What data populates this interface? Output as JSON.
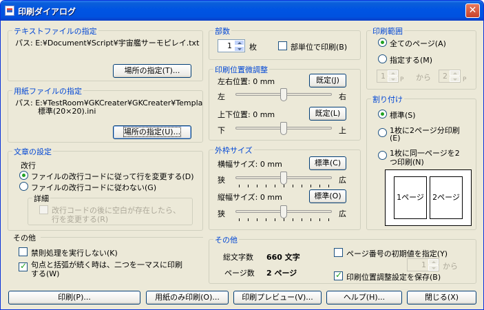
{
  "title": "印刷ダイアログ",
  "text_file": {
    "label": "テキストファイルの指定",
    "path": "パス: E:¥Document¥Script¥宇宙艦サーモピレイ.txt",
    "btn": "場所の指定(T)..."
  },
  "paper_file": {
    "label": "用紙ファイルの指定",
    "path_line1": "パス: E:¥TestRoom¥GKCreater¥GKCreater¥Templa",
    "path_line2": "標準(20×20).ini",
    "btn": "場所の指定(U)..."
  },
  "text_settings": {
    "label": "文章の設定",
    "newline_label": "改行",
    "opt1": "ファイルの改行コードに従って行を変更する(D)",
    "opt2": "ファイルの改行コードに従わない(G)",
    "detail_label": "詳細",
    "detail_chk_line1": "改行コードの後に空白が存在したら、",
    "detail_chk_line2": "行を変更する(R)"
  },
  "other_left": {
    "label": "その他",
    "chk1": "禁則処理を実行しない(K)",
    "chk2_line1": "句点と括弧が続く時は、二つを一マスに印刷",
    "chk2_line2": "する(W)"
  },
  "copies": {
    "label": "部数",
    "value": "1",
    "unit": "枚",
    "collate": "部単位で印刷(B)"
  },
  "position": {
    "label": "印刷位置微調整",
    "lr_label": "左右位置:  0 mm",
    "lr_btn": "既定(J)",
    "left": "左",
    "right": "右",
    "ud_label": "上下位置:  0 mm",
    "ud_btn": "既定(L)",
    "down": "下",
    "up": "上",
    "lr_level": 0.5,
    "ud_level": 0.5
  },
  "frame": {
    "label": "外枠サイズ",
    "w_label": "横幅サイズ:  0 mm",
    "w_btn": "標準(C)",
    "narrow": "狭",
    "wide": "広",
    "h_label": "縦幅サイズ:  0 mm",
    "h_btn": "標準(O)",
    "w_level": 0.5,
    "h_level": 0.5
  },
  "other_bottom": {
    "label": "その他",
    "total_chars_label": "総文字数",
    "total_chars_value": "660 文字",
    "pages_label": "ページ数",
    "pages_value": "2 ページ",
    "page_num_chk": "ページ番号の初期値を指定(Y)",
    "page_num_value": "1",
    "page_num_from": "から",
    "save_chk": "印刷位置調整設定を保存(B)"
  },
  "range": {
    "label": "印刷範囲",
    "all": "全てのページ(A)",
    "specify": "指定する(M)",
    "from_value": "1",
    "from_unit": "P",
    "from_word": "から",
    "to_value": "2",
    "to_unit": "P"
  },
  "layout": {
    "label": "割り付け",
    "std": "標準(S)",
    "two_line1": "1枚に2ページ分印刷",
    "two_line2": "(E)",
    "same_line1": "1枚に同一ページを2",
    "same_line2": "つ印刷(N)",
    "page1": "1ページ",
    "page2": "2ページ"
  },
  "buttons": {
    "print": "印刷(P)...",
    "paper_only": "用紙のみ印刷(O)...",
    "preview": "印刷プレビュー(V)...",
    "help": "ヘルプ(H)...",
    "close": "閉じる(X)"
  },
  "colors": {
    "title_bar": "#0054e3",
    "group_label": "#0046d5",
    "face": "#ece9d8"
  }
}
